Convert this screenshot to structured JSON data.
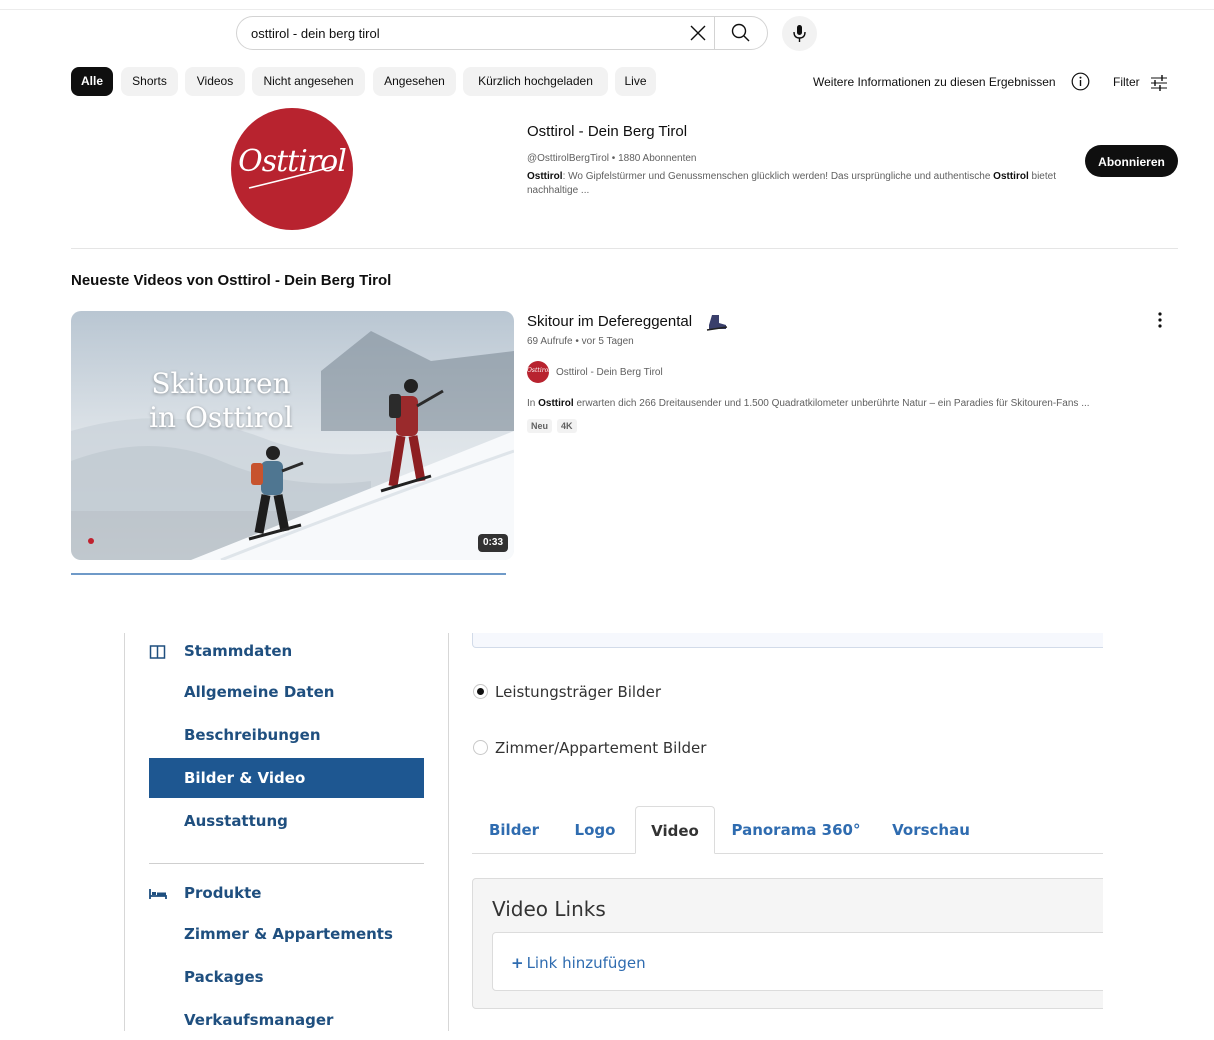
{
  "search": {
    "value": "osttirol - dein berg tirol",
    "clear_icon": "close-icon",
    "search_icon": "magnifier-icon",
    "mic_icon": "microphone-icon"
  },
  "chips": [
    "Alle",
    "Shorts",
    "Videos",
    "Nicht angesehen",
    "Angesehen",
    "Kürzlich hochgeladen",
    "Live"
  ],
  "results_bar": {
    "more_info": "Weitere Informationen zu diesen Ergebnissen",
    "filter": "Filter"
  },
  "channel": {
    "avatar_text": "Osttirol",
    "name": "Osttirol - Dein Berg Tirol",
    "meta": "@OsttirolBergTirol • 1880 Abonnenten",
    "desc_bold": "Osttirol",
    "desc_part1": ": Wo Gipfelstürmer und Genussmenschen glücklich werden! Das ursprüngliche und authentische ",
    "desc_bold2": "Osttirol",
    "desc_part2": " bietet nachhaltige ...",
    "subscribe": "Abonnieren",
    "brand_color": "#b8232f"
  },
  "latest": {
    "title": "Neueste Videos von Osttirol - Dein Berg Tirol"
  },
  "video": {
    "thumb_line1": "Skitouren",
    "thumb_line2": "in Osttirol",
    "duration": "0:33",
    "title": "Skitour im Defereggental",
    "meta": "69 Aufrufe • vor 5 Tagen",
    "channel": "Osttirol - Dein Berg Tirol",
    "desc_prefix": "In ",
    "desc_bold": "Osttirol",
    "desc_rest": " erwarten dich 266 Dreitausender und 1.500 Quadratkilometer unberührte Natur – ein Paradies für Skitouren-Fans ...",
    "badges": [
      "Neu",
      "4K"
    ]
  },
  "sidebar": {
    "group1": "Stammdaten",
    "group1_items": [
      "Allgemeine Daten",
      "Beschreibungen",
      "Bilder & Video",
      "Ausstattung"
    ],
    "group2": "Produkte",
    "group2_items": [
      "Zimmer & Appartements",
      "Packages",
      "Verkaufsmanager"
    ],
    "active_color": "#1e5791"
  },
  "media": {
    "radio1": "Leistungsträger Bilder",
    "radio2": "Zimmer/Appartement Bilder",
    "tabs": [
      "Bilder",
      "Logo",
      "Video",
      "Panorama 360°",
      "Vorschau"
    ],
    "panel_title": "Video Links",
    "add_link": "Link hinzufügen"
  }
}
